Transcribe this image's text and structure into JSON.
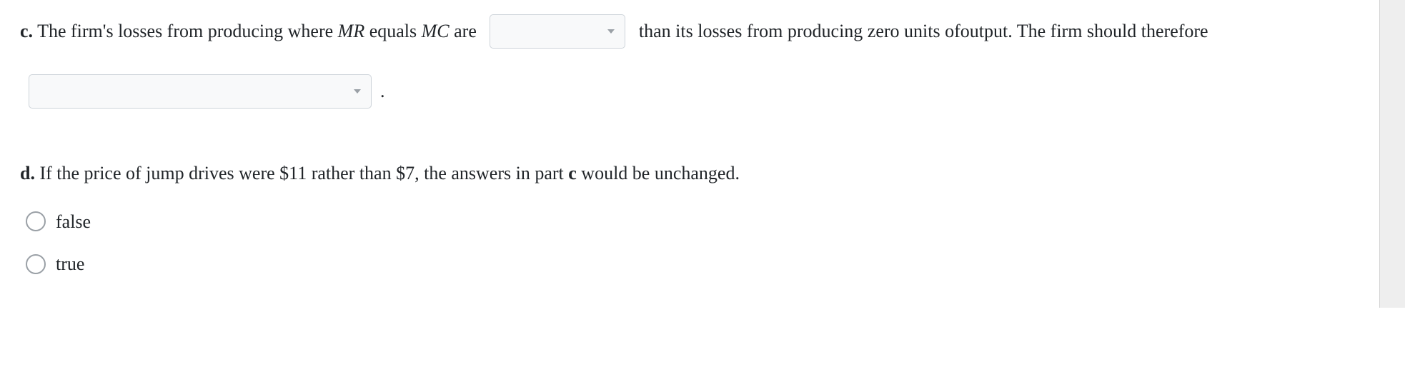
{
  "partC": {
    "label": "c.",
    "seg1": " The firm's losses from producing where ",
    "mr": "MR",
    "seg2": " equals ",
    "mc": "MC",
    "seg3": " are ",
    "seg4": " than its losses from producing zero units of",
    "seg5": "output. The firm should therefore ",
    "period": "."
  },
  "partD": {
    "label": "d.",
    "seg1": " If the price of jump drives were $11 rather than $7, the answers in part ",
    "cref": "c",
    "seg2": " would be unchanged.",
    "options": {
      "false": "false",
      "true": "true"
    }
  }
}
